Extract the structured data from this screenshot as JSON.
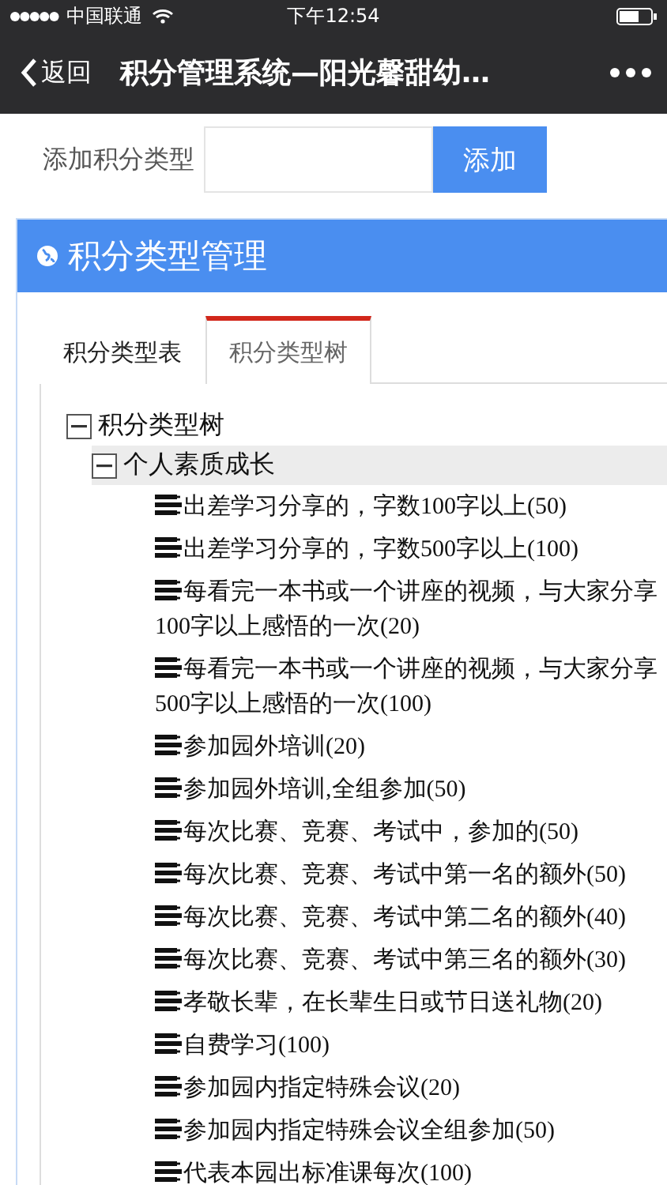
{
  "status_bar": {
    "carrier": "中国联通",
    "time": "下午12:54"
  },
  "nav": {
    "back": "返回",
    "title": "积分管理系统—阳光馨甜幼…"
  },
  "add_form": {
    "label": "添加积分类型",
    "button": "添加"
  },
  "panel": {
    "title": "积分类型管理",
    "tabs": [
      {
        "label": "积分类型表",
        "selected": false
      },
      {
        "label": "积分类型树",
        "selected": true
      }
    ],
    "tree": [
      {
        "label": "积分类型树",
        "expanded": true,
        "selected": false,
        "children": [
          {
            "label": "个人素质成长",
            "expanded": true,
            "selected": true,
            "children": [
              {
                "label": "出差学习分享的，字数100字以上(50)",
                "selected": false
              },
              {
                "label": "出差学习分享的，字数500字以上(100)",
                "selected": false
              },
              {
                "label": "每看完一本书或一个讲座的视频，与大家分享100字以上感悟的一次(20)",
                "selected": false
              },
              {
                "label": "每看完一本书或一个讲座的视频，与大家分享500字以上感悟的一次(100)",
                "selected": false
              },
              {
                "label": "参加园外培训(20)",
                "selected": false
              },
              {
                "label": "参加园外培训,全组参加(50)",
                "selected": false
              },
              {
                "label": "每次比赛、竞赛、考试中，参加的(50)",
                "selected": false
              },
              {
                "label": "每次比赛、竞赛、考试中第一名的额外(50)",
                "selected": false
              },
              {
                "label": "每次比赛、竞赛、考试中第二名的额外(40)",
                "selected": false
              },
              {
                "label": "每次比赛、竞赛、考试中第三名的额外(30)",
                "selected": false
              },
              {
                "label": "孝敬长辈，在长辈生日或节日送礼物(20)",
                "selected": false
              },
              {
                "label": "自费学习(100)",
                "selected": false
              },
              {
                "label": "参加园内指定特殊会议(20)",
                "selected": false
              },
              {
                "label": "参加园内指定特殊会议全组参加(50)",
                "selected": false
              },
              {
                "label": "代表本园出标准课每次(100)",
                "selected": false
              }
            ]
          }
        ]
      }
    ]
  }
}
